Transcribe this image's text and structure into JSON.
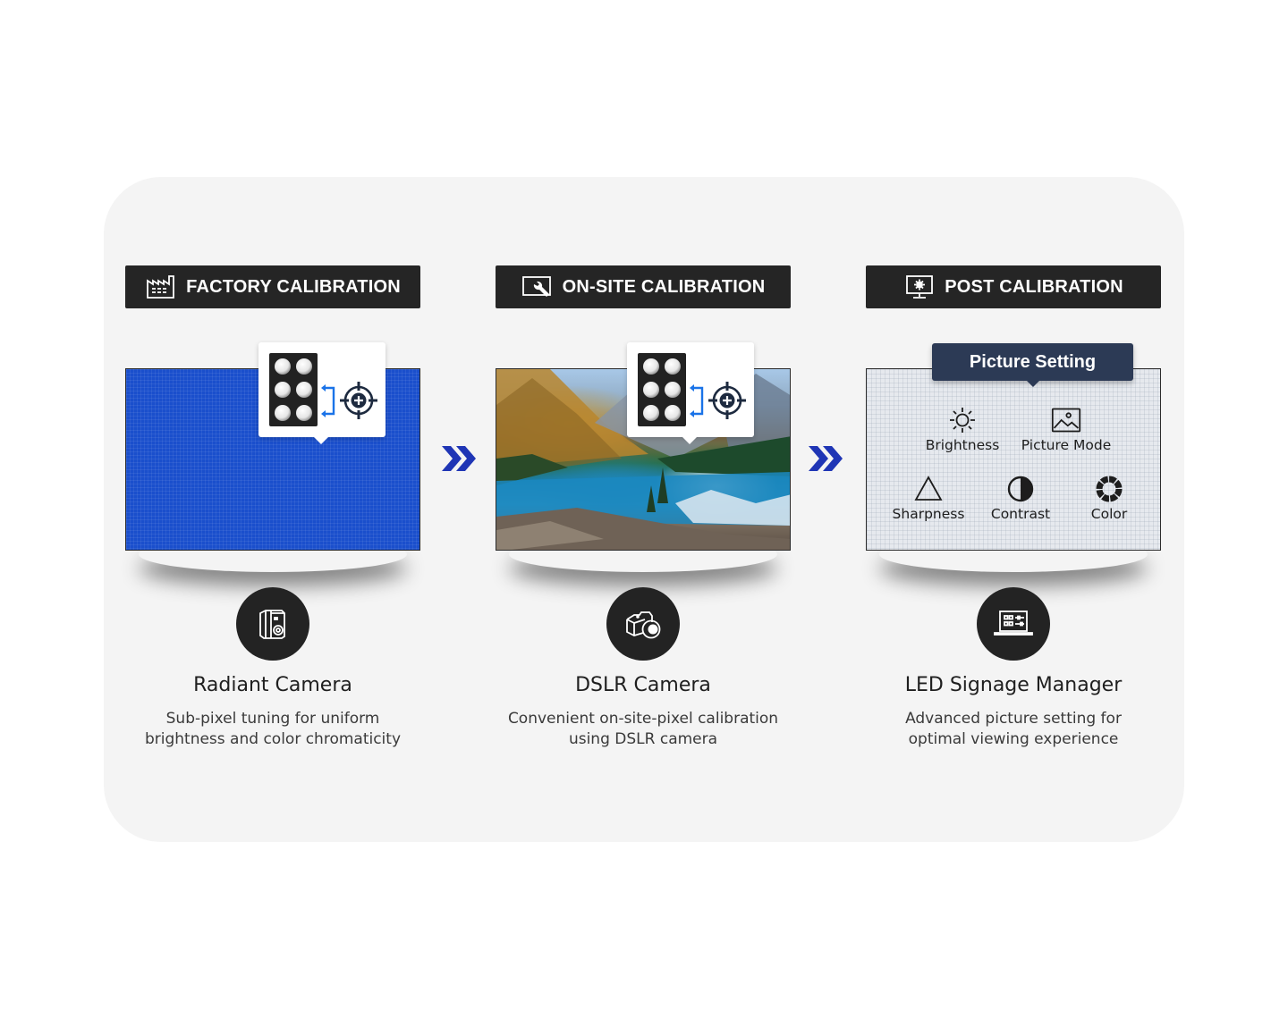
{
  "stages": [
    {
      "header": "FACTORY CALIBRATION",
      "header_icon": "factory-icon",
      "screen": "blue-led-panel",
      "tool_icon": "radiant-camera-icon",
      "title": "Radiant Camera",
      "description": [
        "Sub-pixel tuning for uniform",
        "brightness and color chromaticity"
      ]
    },
    {
      "header": "ON-SITE CALIBRATION",
      "header_icon": "monitor-wrench-icon",
      "screen": "landscape-photo",
      "tool_icon": "dslr-camera-icon",
      "title": "DSLR Camera",
      "description": [
        "Convenient on-site-pixel calibration",
        "using DSLR camera"
      ]
    },
    {
      "header": "POST CALIBRATION",
      "header_icon": "monitor-settings-icon",
      "screen": "picture-setting-menu",
      "tool_icon": "laptop-sliders-icon",
      "title": "LED Signage Manager",
      "description": [
        "Advanced picture setting for",
        "optimal viewing experience"
      ]
    }
  ],
  "picture_setting": {
    "title": "Picture Setting",
    "options": [
      {
        "label": "Brightness",
        "icon": "sun-icon"
      },
      {
        "label": "Picture Mode",
        "icon": "image-icon"
      },
      {
        "label": "Sharpness",
        "icon": "triangle-icon"
      },
      {
        "label": "Contrast",
        "icon": "half-circle-icon"
      },
      {
        "label": "Color",
        "icon": "color-wheel-icon"
      }
    ]
  },
  "colors": {
    "panel_bg": "#f4f4f4",
    "header_bg": "#252525",
    "accent_blue": "#1f35b5",
    "led_blue": "#1a4fcc",
    "tag_bg": "#2c3a55",
    "arrow_blue": "#1a73e8"
  }
}
